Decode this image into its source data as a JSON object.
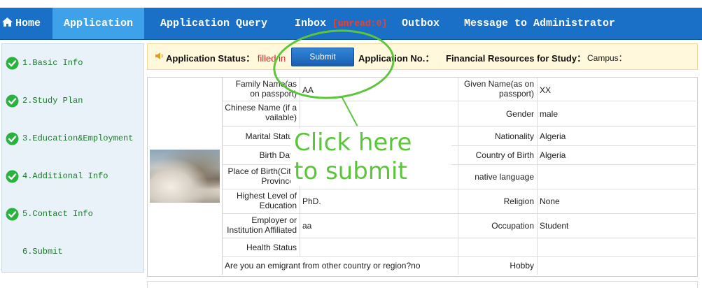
{
  "nav": {
    "home": "Home",
    "application": "Application",
    "application_query": "Application Query",
    "inbox": "Inbox",
    "unread": "[unread:0]",
    "outbox": "Outbox",
    "message_admin": "Message to Administrator",
    "active_color": "#3ea2ea",
    "bar_color": "#1a6fc6"
  },
  "sidebar": {
    "items": [
      {
        "label": "1.Basic Info",
        "done": true
      },
      {
        "label": "2.Study Plan",
        "done": true
      },
      {
        "label": "3.Education&Employment",
        "done": true
      },
      {
        "label": "4.Additional Info",
        "done": true
      },
      {
        "label": "5.Contact Info",
        "done": true
      },
      {
        "label": "6.Submit",
        "done": false
      }
    ]
  },
  "status": {
    "label": "Application Status：",
    "value": "filled in",
    "submit": "Submit",
    "application_no": "Application No.：",
    "financial": "Financial Resources for Study：",
    "campus": "Campus："
  },
  "form": {
    "family_name_label": "Family Name(as on passport)",
    "family_name_value": "AA",
    "given_name_label": "Given Name(as on passport)",
    "given_name_value": "XX",
    "chinese_name_label": "Chinese Name (if a vailable)",
    "chinese_name_value": "",
    "gender_label": "Gender",
    "gender_value": "male",
    "marital_label": "Marital Status",
    "marital_value": "",
    "nationality_label": "Nationality",
    "nationality_value": "Algeria",
    "birth_date_label": "Birth Date",
    "birth_date_value": "",
    "country_birth_label": "Country of Birth",
    "country_birth_value": "Algeria",
    "place_birth_label": "Place of Birth(City, Province)",
    "place_birth_value": "",
    "native_lang_label": "native language",
    "native_lang_value": "",
    "highest_level_label": "Highest Level of Education",
    "highest_level_value": "PhD.",
    "religion_label": "Religion",
    "religion_value": "None",
    "employer_label": "Employer or Institution Affiliated",
    "employer_value": "aa",
    "occupation_label": "Occupation",
    "occupation_value": "Student",
    "health_label": "Health Status",
    "health_value": "",
    "emigrant_label": "Are you an emigrant from other country or region?",
    "emigrant_value": "no",
    "hobby_label": "Hobby",
    "hobby_value": ""
  },
  "annotation": {
    "line1": "Click here",
    "line2": "to submit",
    "color": "#5cc63a"
  }
}
